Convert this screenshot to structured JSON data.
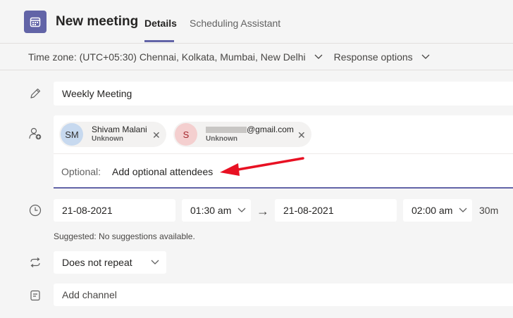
{
  "header": {
    "title": "New meeting",
    "tabs": [
      {
        "label": "Details",
        "active": true
      },
      {
        "label": "Scheduling Assistant",
        "active": false
      }
    ],
    "accent": "#6264a7"
  },
  "subbar": {
    "timezone": "Time zone: (UTC+05:30) Chennai, Kolkata, Mumbai, New Delhi",
    "response_options": "Response options"
  },
  "form": {
    "title_value": "Weekly Meeting",
    "attendees": [
      {
        "initials": "SM",
        "name": "Shivam Malani",
        "status": "Unknown",
        "avatar_bg": "#c7d9ef",
        "avatar_fg": "#323130"
      },
      {
        "initials": "S",
        "name": "@gmail.com",
        "status": "Unknown",
        "avatar_bg": "#f4cfcf",
        "avatar_fg": "#a4262c"
      }
    ],
    "optional_label": "Optional:",
    "optional_placeholder": "Add optional attendees",
    "start_date": "21-08-2021",
    "start_time": "01:30 am",
    "end_date": "21-08-2021",
    "end_time": "02:00 am",
    "duration": "30m",
    "suggestion": "Suggested: No suggestions available.",
    "repeat": "Does not repeat",
    "channel_placeholder": "Add channel"
  },
  "annotation": {
    "arrow_color": "#e81123"
  }
}
